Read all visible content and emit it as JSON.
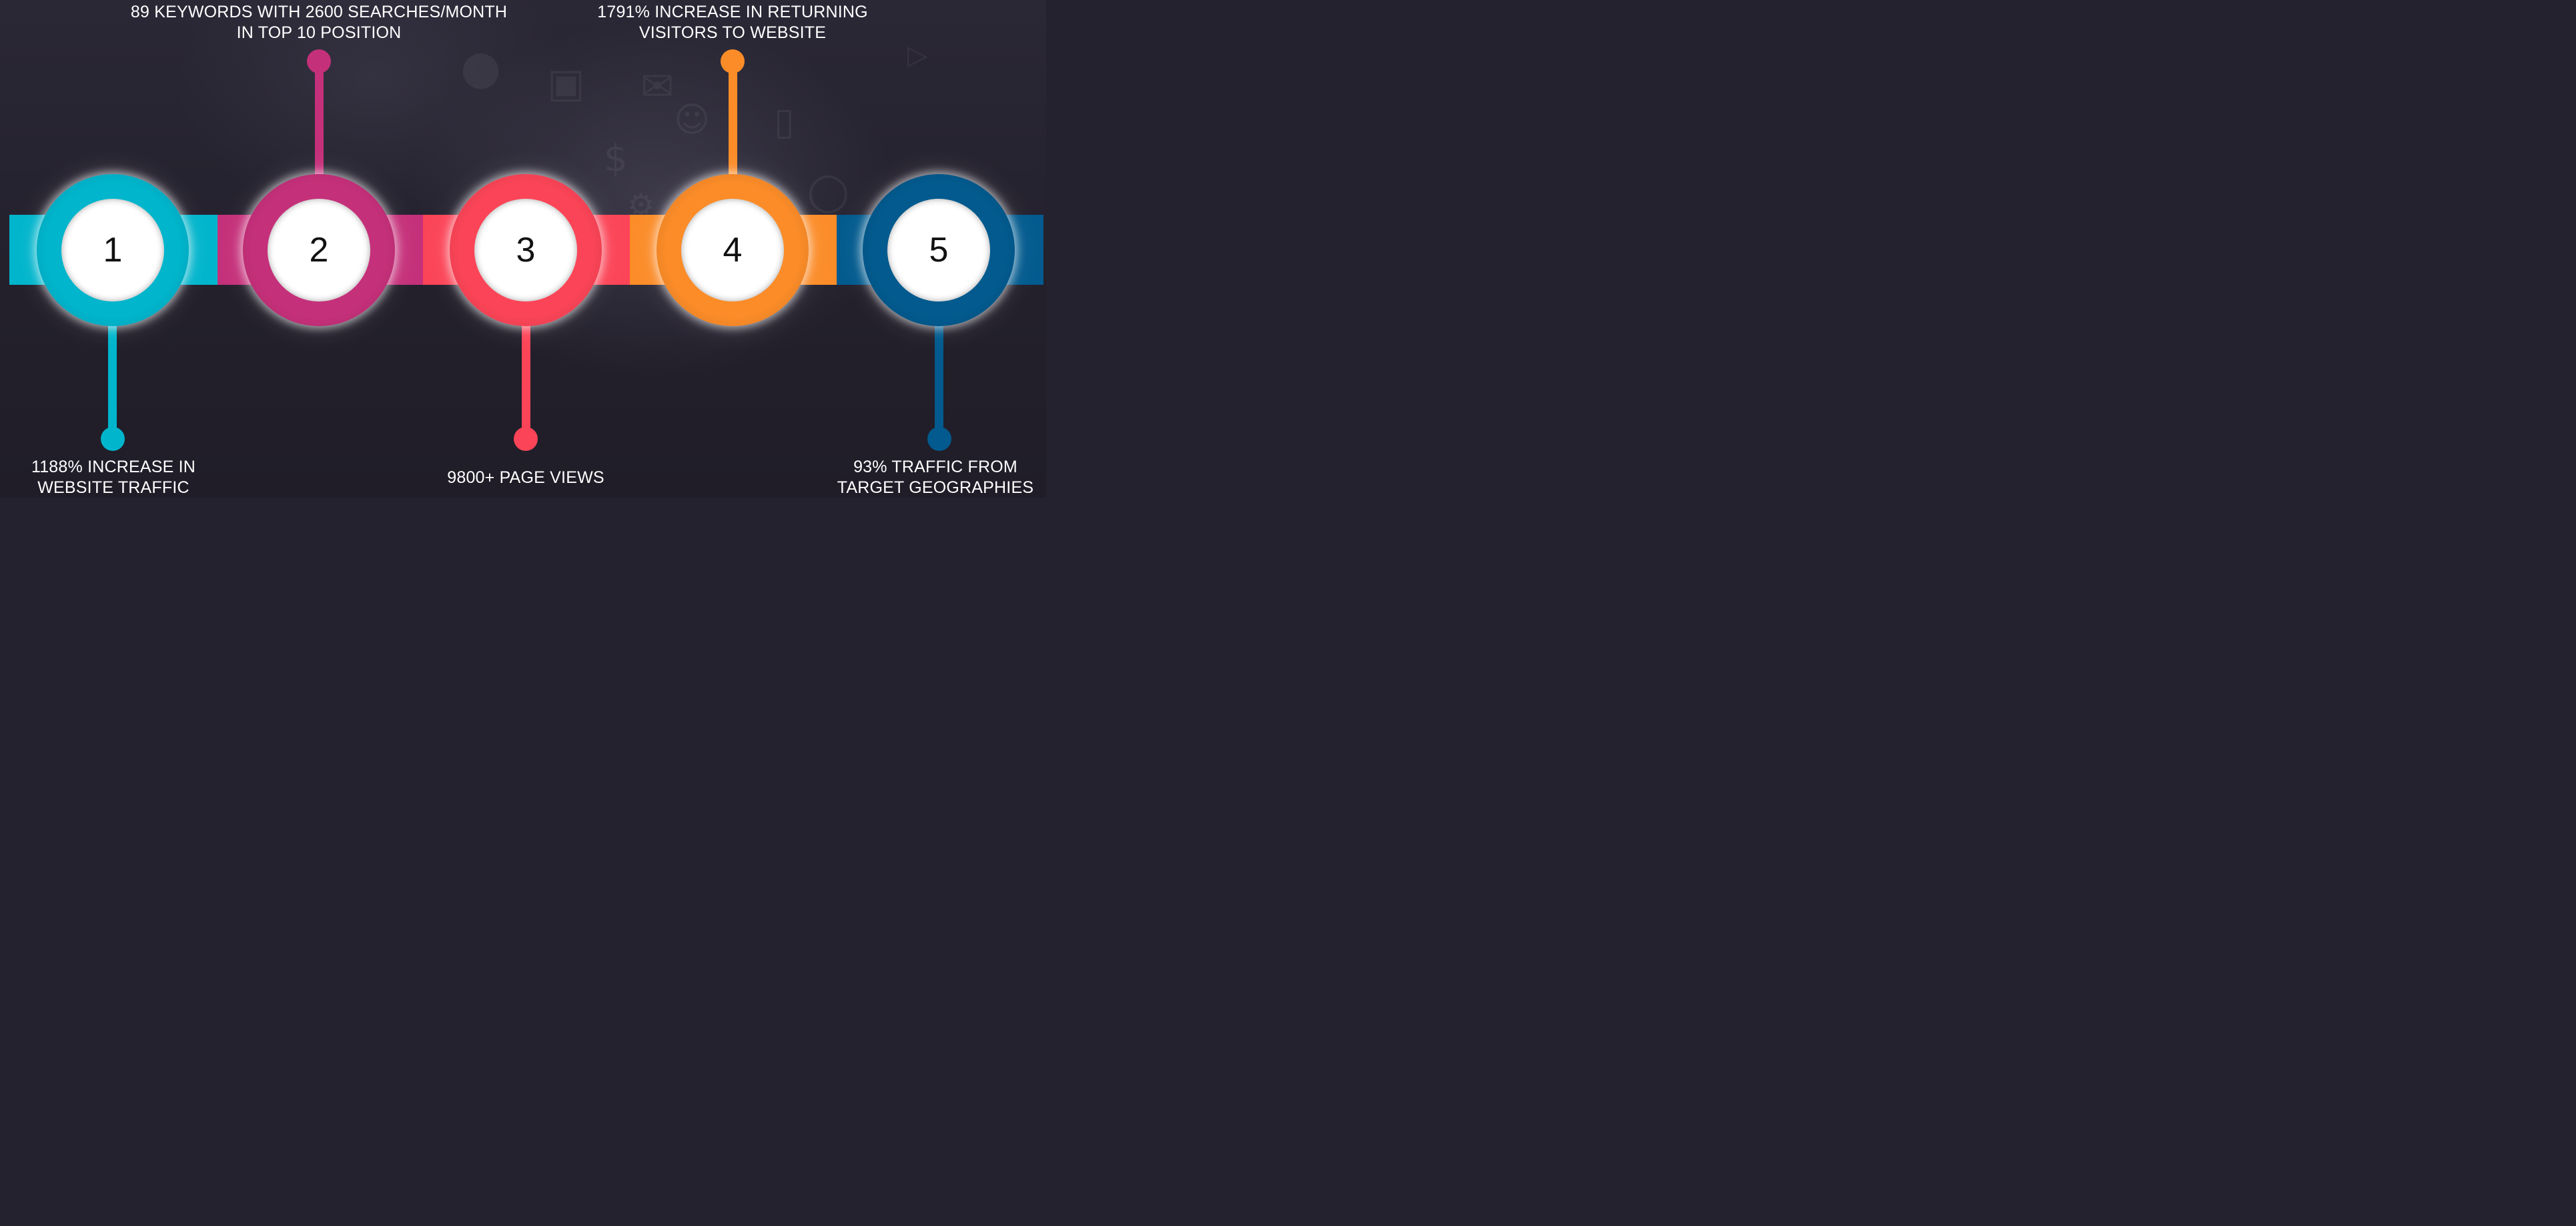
{
  "theme": {
    "background": "#25222f",
    "colors": {
      "cyan": "#00b5cc",
      "magenta": "#c5307a",
      "coral": "#fb4457",
      "orange": "#fb8c28",
      "navy": "#025a8e"
    }
  },
  "background_icons": [
    "lightbulb-icon",
    "camera-icon",
    "envelope-icon",
    "people-icon",
    "dollar-icon",
    "globe-icon",
    "phone-icon",
    "gear-icon",
    "play-icon"
  ],
  "steps": [
    {
      "number": "1",
      "color": "#00b5cc",
      "label_position": "bottom",
      "label_lines": [
        "1188% INCREASE IN",
        "WEBSITE TRAFFIC"
      ]
    },
    {
      "number": "2",
      "color": "#c5307a",
      "label_position": "top",
      "label_lines": [
        "89 KEYWORDS WITH 2600 SEARCHES/MONTH",
        "IN TOP 10 POSITION"
      ]
    },
    {
      "number": "3",
      "color": "#fb4457",
      "label_position": "bottom",
      "label_lines": [
        "9800+ PAGE VIEWS"
      ]
    },
    {
      "number": "4",
      "color": "#fb8c28",
      "label_position": "top",
      "label_lines": [
        "1791% INCREASE IN RETURNING",
        "VISITORS TO WEBSITE"
      ]
    },
    {
      "number": "5",
      "color": "#025a8e",
      "label_position": "bottom",
      "label_lines": [
        "93% TRAFFIC FROM",
        "TARGET GEOGRAPHIES"
      ]
    }
  ]
}
